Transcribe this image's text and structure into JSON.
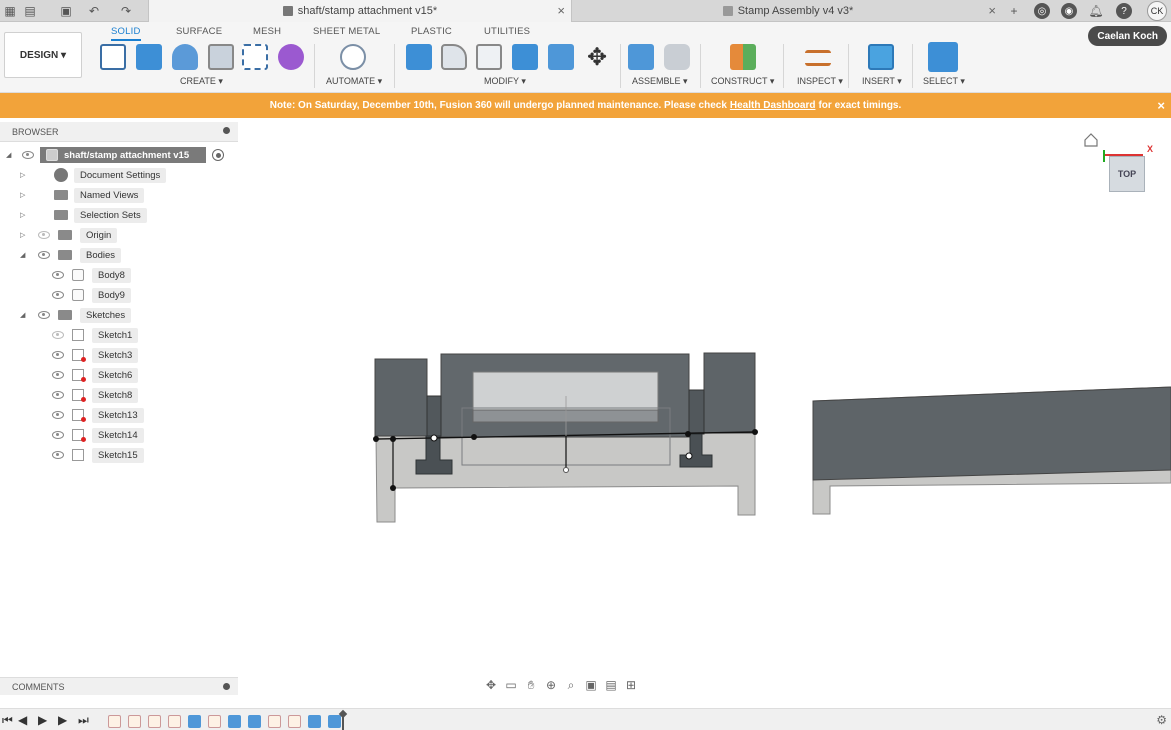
{
  "tabs": {
    "active_doc": "shaft/stamp attachment v15*",
    "other_doc": "Stamp Assembly v4 v3*",
    "user_initials": "CK"
  },
  "toolbar": {
    "design_label": "DESIGN",
    "workspace_tabs": [
      "SOLID",
      "SURFACE",
      "MESH",
      "SHEET METAL",
      "PLASTIC",
      "UTILITIES"
    ],
    "groups": [
      "CREATE",
      "AUTOMATE",
      "MODIFY",
      "ASSEMBLE",
      "CONSTRUCT",
      "INSPECT",
      "INSERT",
      "SELECT"
    ],
    "user_name": "Caelan Koch"
  },
  "banner": {
    "prefix": "Note: On Saturday, December 10th, Fusion 360 will undergo planned maintenance. Please check",
    "link": "Health Dashboard",
    "suffix": "for exact timings."
  },
  "browser": {
    "header": "BROWSER",
    "root": "shaft/stamp attachment v15",
    "items": [
      {
        "label": "Document Settings"
      },
      {
        "label": "Named Views"
      },
      {
        "label": "Selection Sets"
      },
      {
        "label": "Origin"
      },
      {
        "label": "Bodies"
      },
      {
        "label": "Body8"
      },
      {
        "label": "Body9"
      },
      {
        "label": "Sketches"
      },
      {
        "label": "Sketch1"
      },
      {
        "label": "Sketch3"
      },
      {
        "label": "Sketch6"
      },
      {
        "label": "Sketch8"
      },
      {
        "label": "Sketch13"
      },
      {
        "label": "Sketch14"
      },
      {
        "label": "Sketch15"
      }
    ]
  },
  "comments": {
    "header": "COMMENTS"
  },
  "viewcube": {
    "face": "TOP",
    "axis": "X"
  }
}
